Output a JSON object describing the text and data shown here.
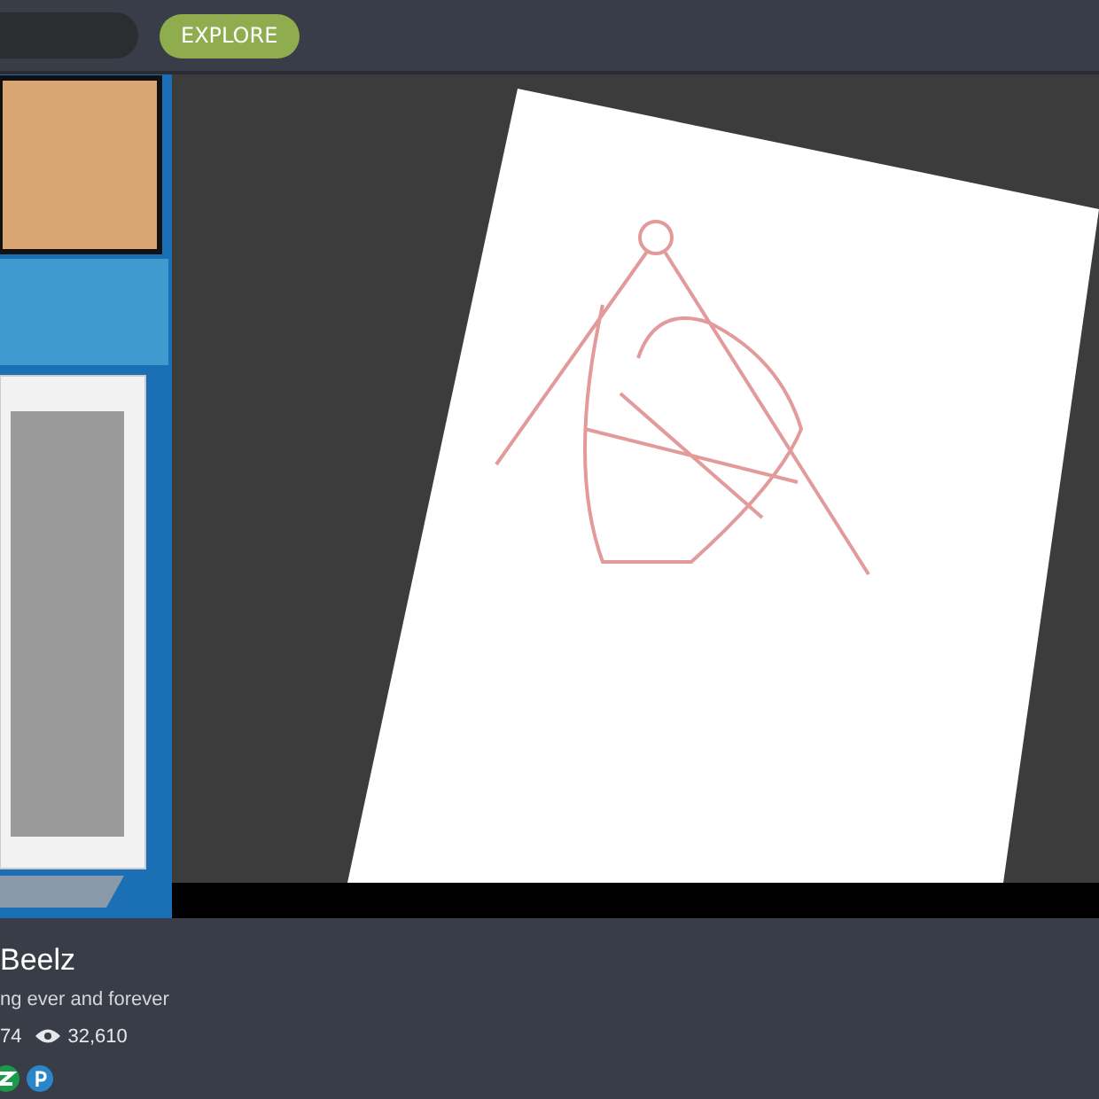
{
  "header": {
    "explore_button": "EXPLORE"
  },
  "channel": {
    "name": "Beelz",
    "description": "ng ever and forever",
    "followers": "74",
    "views": "32,610"
  }
}
